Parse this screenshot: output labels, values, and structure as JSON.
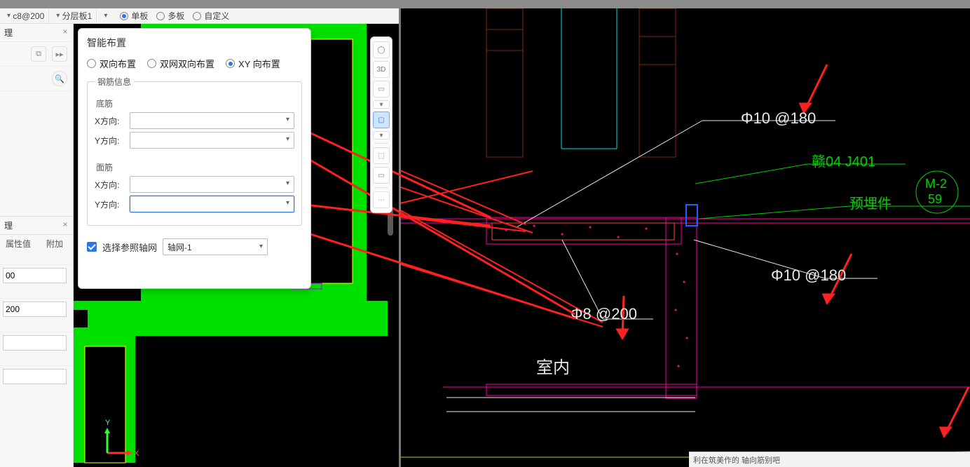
{
  "toolbar": {
    "dropdown1": "c8@200",
    "dropdown2": "分层板1",
    "radios": {
      "r1": "单板",
      "r2": "多板",
      "r3": "自定义"
    },
    "selected_radio": "r1"
  },
  "left_panel": {
    "section1_title": "理",
    "section2_title": "理",
    "tab1": "属性值",
    "tab2": "附加",
    "input1": "00",
    "input2": "200"
  },
  "palette3d": {
    "b1": "globe-icon",
    "b2": "3D",
    "b3": "cube-top-icon",
    "b4": "cube-bottom-icon",
    "b5": "select-box-icon",
    "b6": "rect-icon",
    "b7": "more-icon"
  },
  "dialog": {
    "title": "智能布置",
    "layout_radios": {
      "r1": "双向布置",
      "r2": "双网双向布置",
      "r3": "XY 向布置"
    },
    "layout_selected": "r3",
    "fieldset_title": "钢筋信息",
    "group_bottom": "底筋",
    "group_top": "面筋",
    "label_x": "X方向:",
    "label_y": "Y方向:",
    "bottom_x": "",
    "bottom_y": "",
    "top_x": "",
    "top_y": "",
    "ref_grid_label": "选择参照轴网",
    "ref_grid_value": "轴网-1"
  },
  "detail_annotations": {
    "rebar1": "Φ10 @180",
    "code": "赣04 J401",
    "embed": "预埋件",
    "mark_top": "M-2",
    "mark_bot": "59",
    "rebar2": "Φ8 @200",
    "rebar3": "Φ10 @180",
    "room": "室内"
  },
  "axis_labels": {
    "x": "X",
    "y": "Y"
  },
  "statusbar": "利在筑美作的   轴向筋别吧",
  "chart_data": {
    "type": "other",
    "note": "CAD structural section detail; numeric values carried in detail_annotations above"
  }
}
